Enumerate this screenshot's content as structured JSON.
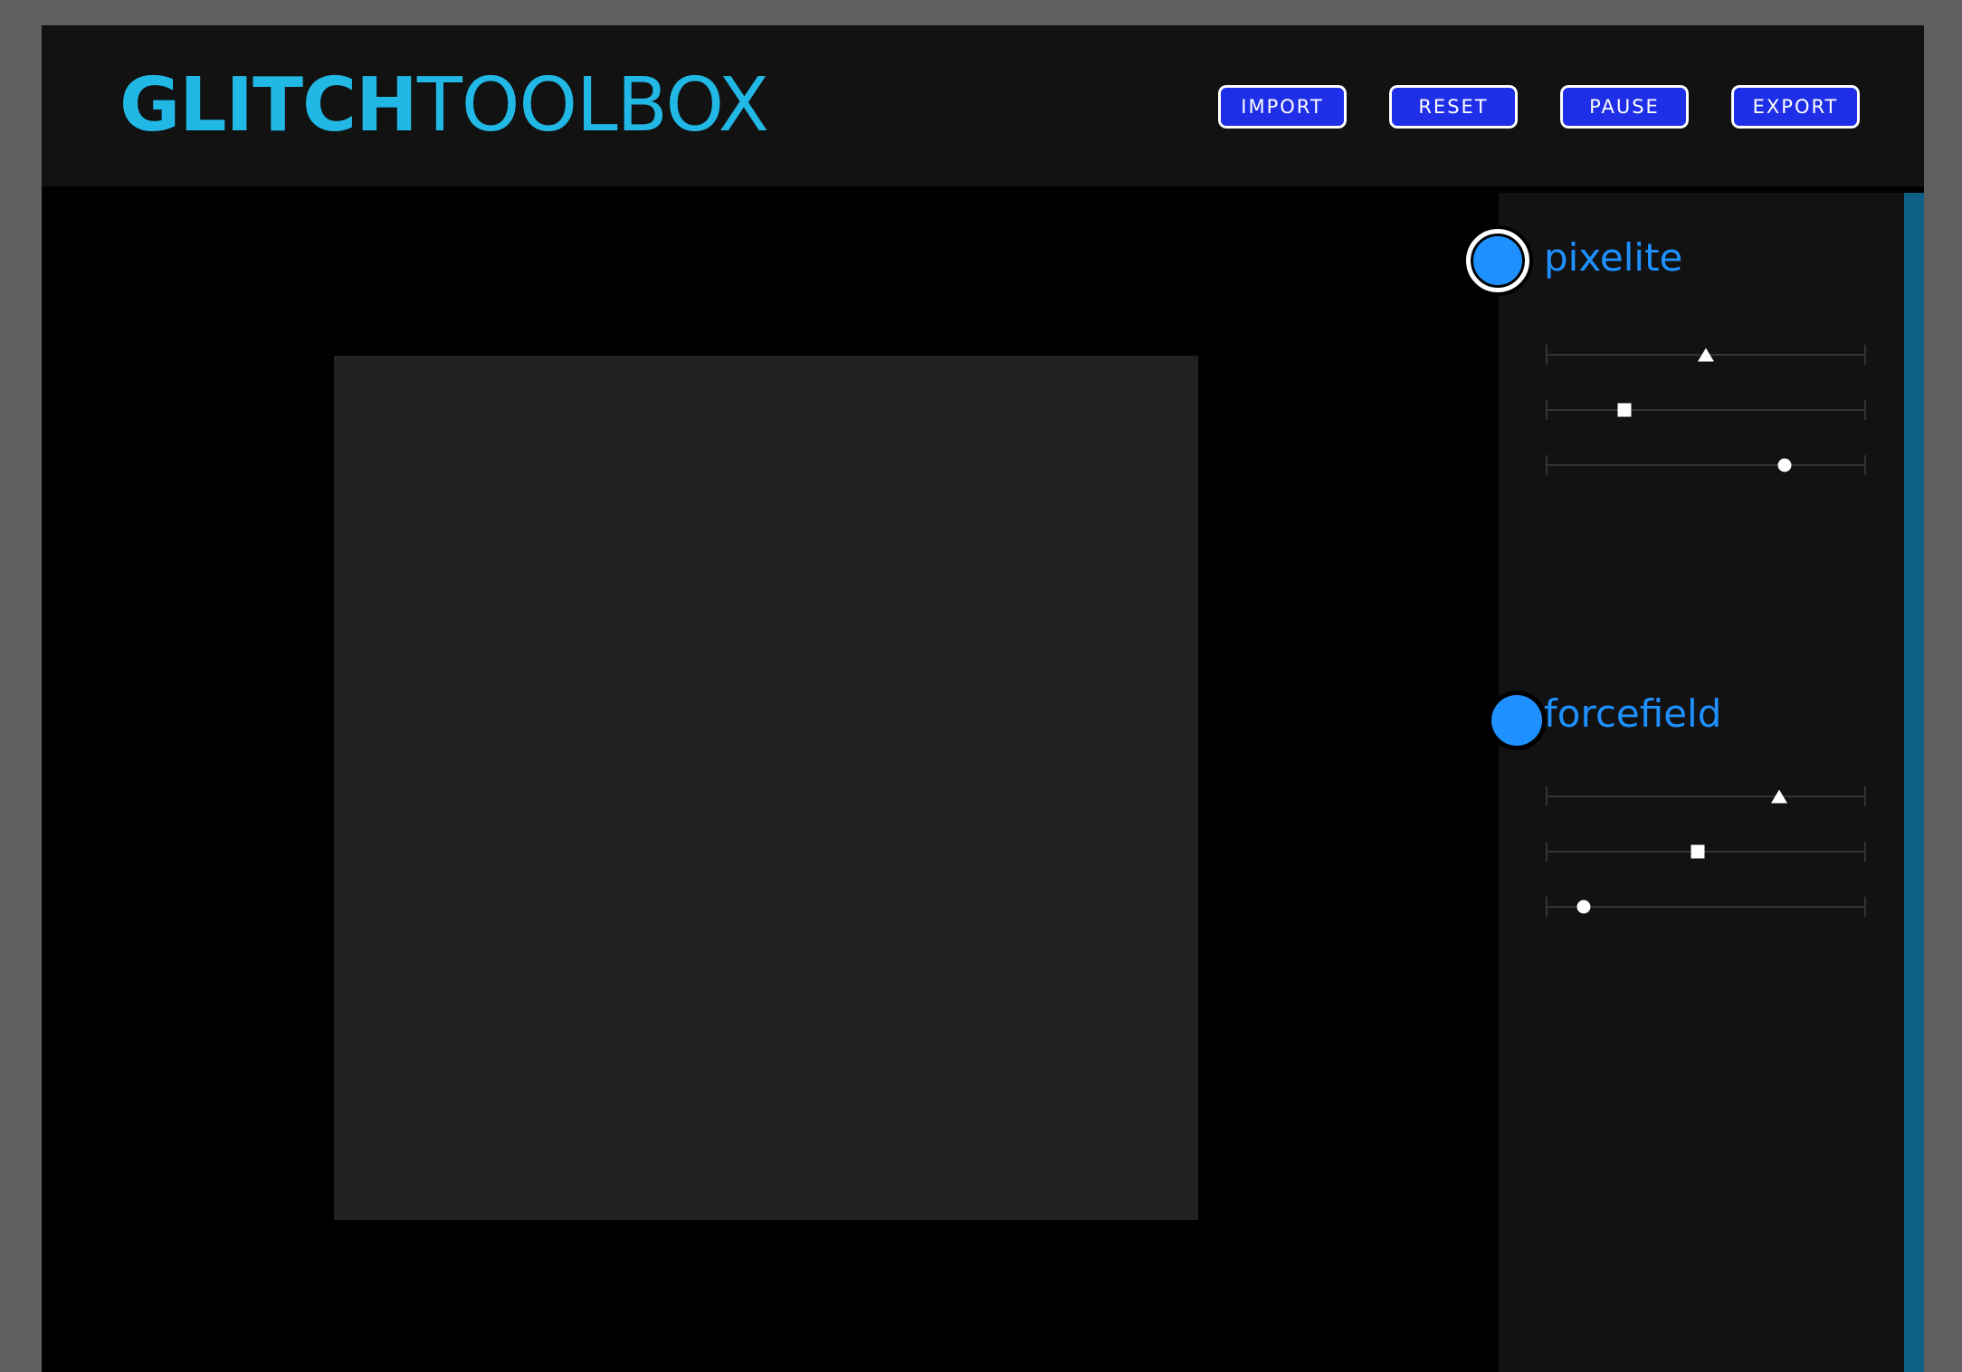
{
  "app": {
    "logo_strong": "GLITCH",
    "logo_light": "TOOLBOX"
  },
  "toolbar": {
    "import_label": "IMPORT",
    "reset_label": "RESET",
    "pause_label": "PAUSE",
    "export_label": "EXPORT"
  },
  "effects": [
    {
      "name": "pixelite",
      "active": true,
      "sliders": [
        {
          "shape": "triangle",
          "value": 0.5
        },
        {
          "shape": "square",
          "value": 0.245
        },
        {
          "shape": "circle",
          "value": 0.745
        }
      ]
    },
    {
      "name": "forcefield",
      "active": false,
      "sliders": [
        {
          "shape": "triangle",
          "value": 0.73
        },
        {
          "shape": "square",
          "value": 0.475
        },
        {
          "shape": "circle",
          "value": 0.12
        }
      ]
    }
  ],
  "colors": {
    "logo": "#21b8e6",
    "accent": "#1e90ff",
    "button_fill": "#1f2fe8",
    "edge": "#0e5f84"
  }
}
